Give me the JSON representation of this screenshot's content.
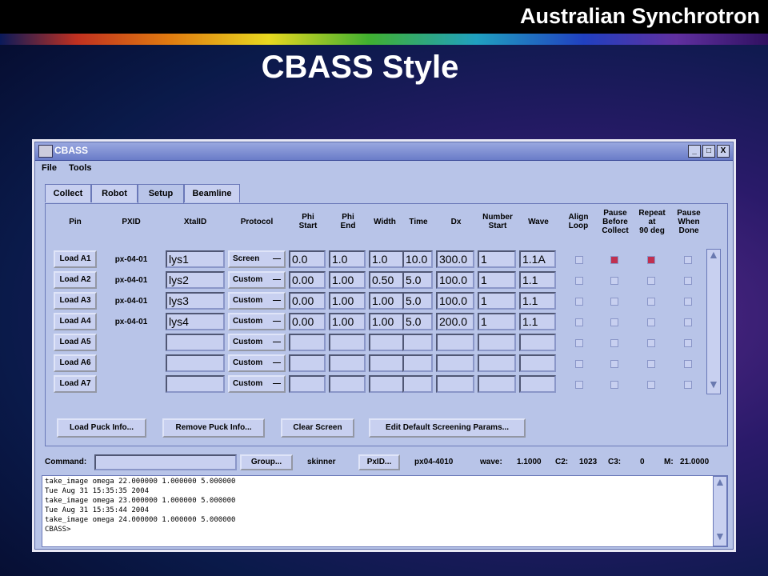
{
  "slide": {
    "brand": "Australian Synchrotron",
    "title": "CBASS Style"
  },
  "window": {
    "title": "CBASS",
    "min": "_",
    "max": "□",
    "close": "X"
  },
  "menu": [
    "File",
    "Tools"
  ],
  "tabs": [
    "Collect",
    "Robot",
    "Setup",
    "Beamline"
  ],
  "headers": [
    {
      "text": "Pin"
    },
    {
      "text": "PXID"
    },
    {
      "text": "XtalID"
    },
    {
      "text": "Protocol"
    },
    {
      "text": "Phi\nStart"
    },
    {
      "text": "Phi\nEnd"
    },
    {
      "text": "Width"
    },
    {
      "text": "Time"
    },
    {
      "text": "Dx"
    },
    {
      "text": "Number\nStart"
    },
    {
      "text": "Wave"
    },
    {
      "text": "Align\nLoop"
    },
    {
      "text": "Pause\nBefore\nCollect"
    },
    {
      "text": "Repeat\nat\n90 deg"
    },
    {
      "text": "Pause\nWhen\nDone"
    }
  ],
  "rows": [
    {
      "pin": "Load A1",
      "pxid": "px-04-01",
      "xtal": "lys1",
      "protocol": "Screen",
      "phi_start": "0.0",
      "phi_end": "1.0",
      "width": "1.0",
      "time": "10.0",
      "dx": "300.0",
      "num": "1",
      "wave": "1.1A",
      "checks": [
        false,
        true,
        true,
        false
      ]
    },
    {
      "pin": "Load A2",
      "pxid": "px-04-01",
      "xtal": "lys2",
      "protocol": "Custom",
      "phi_start": "0.00",
      "phi_end": "1.00",
      "width": "0.50",
      "time": "5.0",
      "dx": "100.0",
      "num": "1",
      "wave": "1.1",
      "checks": [
        false,
        false,
        false,
        false
      ]
    },
    {
      "pin": "Load A3",
      "pxid": "px-04-01",
      "xtal": "lys3",
      "protocol": "Custom",
      "phi_start": "0.00",
      "phi_end": "1.00",
      "width": "1.00",
      "time": "5.0",
      "dx": "100.0",
      "num": "1",
      "wave": "1.1",
      "checks": [
        false,
        false,
        false,
        false
      ]
    },
    {
      "pin": "Load A4",
      "pxid": "px-04-01",
      "xtal": "lys4",
      "protocol": "Custom",
      "phi_start": "0.00",
      "phi_end": "1.00",
      "width": "1.00",
      "time": "5.0",
      "dx": "200.0",
      "num": "1",
      "wave": "1.1",
      "checks": [
        false,
        false,
        false,
        false
      ]
    },
    {
      "pin": "Load A5",
      "pxid": "",
      "xtal": "",
      "protocol": "Custom",
      "phi_start": "",
      "phi_end": "",
      "width": "",
      "time": "",
      "dx": "",
      "num": "",
      "wave": "",
      "checks": [
        false,
        false,
        false,
        false
      ]
    },
    {
      "pin": "Load A6",
      "pxid": "",
      "xtal": "",
      "protocol": "Custom",
      "phi_start": "",
      "phi_end": "",
      "width": "",
      "time": "",
      "dx": "",
      "num": "",
      "wave": "",
      "checks": [
        false,
        false,
        false,
        false
      ]
    },
    {
      "pin": "Load A7",
      "pxid": "",
      "xtal": "",
      "protocol": "Custom",
      "phi_start": "",
      "phi_end": "",
      "width": "",
      "time": "",
      "dx": "",
      "num": "",
      "wave": "",
      "checks": [
        false,
        false,
        false,
        false
      ]
    }
  ],
  "select_dash": "—",
  "actions": {
    "load_puck": "Load Puck Info...",
    "remove_puck": "Remove Puck Info...",
    "clear_screen": "Clear Screen",
    "edit_defaults": "Edit Default Screening Params..."
  },
  "statusbar": {
    "command_label": "Command:",
    "command_value": "",
    "group_btn": "Group...",
    "user": "skinner",
    "pxid_btn": "PxID...",
    "host": "px04-4010",
    "wave_label": "wave:",
    "wave": "1.1000",
    "c2_label": "C2:",
    "c2": "1023",
    "c3_label": "C3:",
    "c3": "0",
    "m_label": "M:",
    "m": "21.0000"
  },
  "console": [
    "take_image omega 22.000000 1.000000 5.000000",
    "Tue Aug 31 15:35:35 2004",
    "take_image omega 23.000000 1.000000 5.000000",
    "Tue Aug 31 15:35:44 2004",
    "take_image omega 24.000000 1.000000 5.000000",
    "CBASS>"
  ],
  "scroll_arrows": {
    "up": "▲",
    "down": "▼"
  }
}
